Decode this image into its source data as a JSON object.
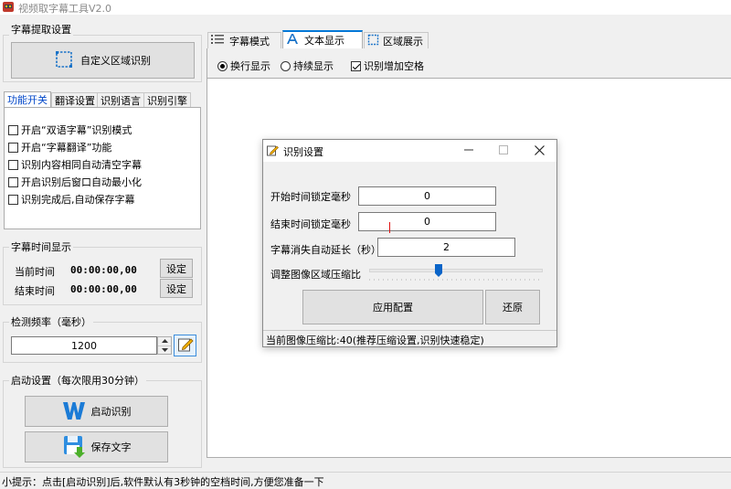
{
  "window": {
    "title": "视频取字幕工具V2.0"
  },
  "extract": {
    "group_title": "字幕提取设置",
    "custom_region_label": "自定义区域识别"
  },
  "left_tabs": [
    {
      "label": "功能开关"
    },
    {
      "label": "翻译设置"
    },
    {
      "label": "识别语言"
    },
    {
      "label": "识别引擎"
    }
  ],
  "features": [
    {
      "label": "开启“双语字幕”识别模式",
      "checked": false
    },
    {
      "label": "开启“字幕翻译”功能",
      "checked": false
    },
    {
      "label": "识别内容相同自动清空字幕",
      "checked": false
    },
    {
      "label": "开启识别后窗口自动最小化",
      "checked": false
    },
    {
      "label": "识别完成后,自动保存字幕",
      "checked": false
    }
  ],
  "timeinfo": {
    "group_title": "字幕时间显示",
    "current_label": "当前时间",
    "current_value": "00:00:00,00",
    "end_label": "结束时间",
    "end_value": "00:00:00,00",
    "set_label": "设定"
  },
  "frequency": {
    "group_title": "检测频率（毫秒）",
    "value": "1200"
  },
  "startup": {
    "group_title": "启动设置（每次限用30分钟）",
    "start_label": "启动识别",
    "save_label": "保存文字"
  },
  "main_tabs": [
    {
      "label": "字幕模式"
    },
    {
      "label": "文本显示"
    },
    {
      "label": "区域展示"
    }
  ],
  "display_options": {
    "line_break": "换行显示",
    "continuous": "持续显示",
    "add_space": "识别增加空格"
  },
  "dialog": {
    "title": "识别设置",
    "start_lock_label": "开始时间锁定毫秒",
    "start_lock_value": "0",
    "end_lock_label": "结束时间锁定毫秒",
    "end_lock_value": "0",
    "extend_label": "字幕消失自动延长（秒）",
    "extend_value": "2",
    "compress_label": "调整图像区域压缩比",
    "compress_value": 0.4,
    "apply_label": "应用配置",
    "restore_label": "还原",
    "status": "当前图像压缩比:40(推荐压缩设置,识别快速稳定)"
  },
  "statusbar": {
    "tip": "小提示：点击[启动识别]后,软件默认有3秒钟的空档时间,方便您准备一下"
  },
  "colors": {
    "accent": "#0078d7",
    "slider_thumb": "#0a64c8"
  }
}
